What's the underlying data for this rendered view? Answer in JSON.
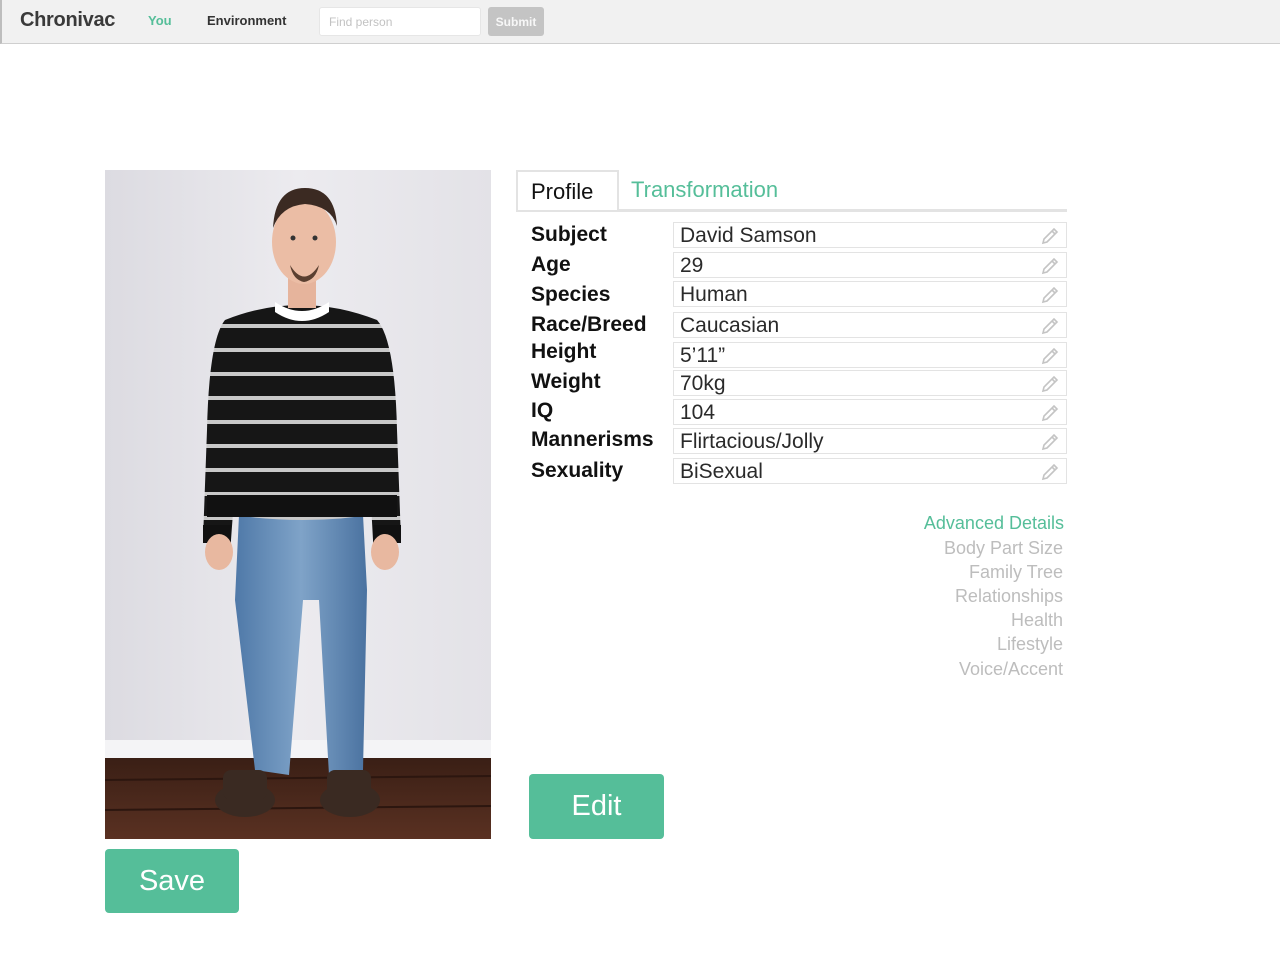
{
  "navbar": {
    "brand": "Chronivac",
    "links": [
      {
        "label": "You",
        "active": true
      },
      {
        "label": "Environment",
        "active": false
      }
    ],
    "search_placeholder": "Find person",
    "search_value": "",
    "submit_label": "Submit"
  },
  "tabs": [
    {
      "label": "Profile",
      "active": true
    },
    {
      "label": "Transformation",
      "active": false
    }
  ],
  "profile": {
    "fields": [
      {
        "label": "Subject",
        "value": "David Samson"
      },
      {
        "label": "Age",
        "value": "29"
      },
      {
        "label": "Species",
        "value": "Human"
      },
      {
        "label": "Race/Breed",
        "value": "Caucasian"
      },
      {
        "label": "Height",
        "value": "5’11”"
      },
      {
        "label": "Weight",
        "value": "70kg"
      },
      {
        "label": "IQ",
        "value": "104"
      },
      {
        "label": "Mannerisms",
        "value": "Flirtacious/Jolly"
      },
      {
        "label": "Sexuality",
        "value": "BiSexual"
      }
    ]
  },
  "advanced": {
    "title": "Advanced Details",
    "items": [
      "Body Part Size",
      "Family Tree",
      "Relationships",
      "Health",
      "Lifestyle",
      "Voice/Accent"
    ]
  },
  "buttons": {
    "save_label": "Save",
    "edit_label": "Edit"
  },
  "colors": {
    "accent": "#55be99",
    "muted_text": "#bdbdbd",
    "nav_bg": "#f1f1f1"
  }
}
